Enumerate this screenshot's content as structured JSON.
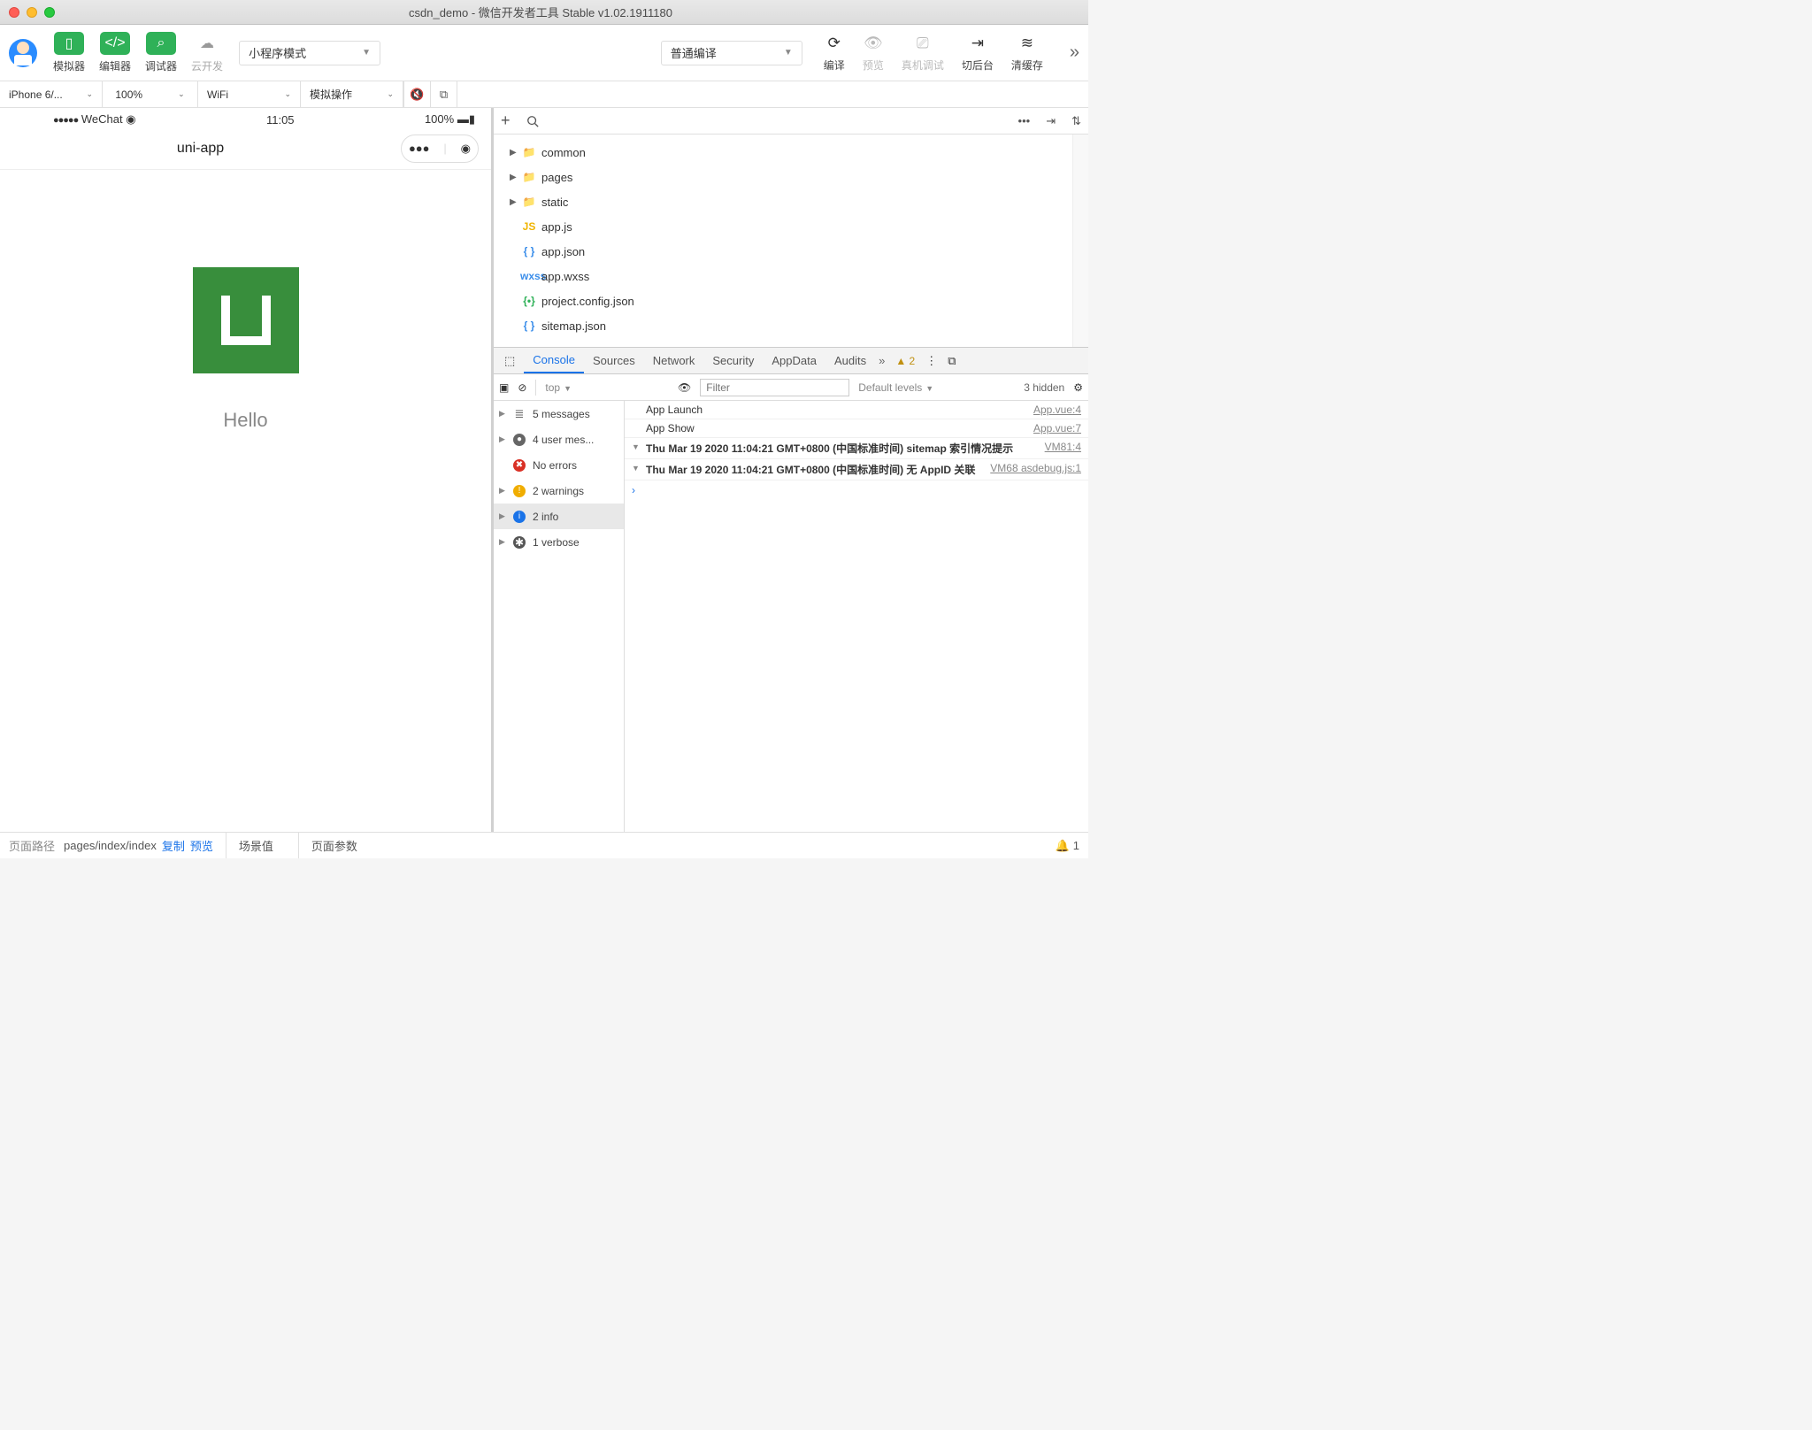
{
  "window": {
    "title": "csdn_demo - 微信开发者工具 Stable v1.02.1911180"
  },
  "toolbar": {
    "simulator": "模拟器",
    "editor": "编辑器",
    "debugger": "调试器",
    "cloud": "云开发",
    "mode": "小程序模式",
    "compile_mode": "普通编译",
    "compile": "编译",
    "preview": "预览",
    "remote_debug": "真机调试",
    "background": "切后台",
    "clear_cache": "清缓存"
  },
  "secbar": {
    "device": "iPhone 6/...",
    "zoom": "100%",
    "network": "WiFi",
    "sim_action": "模拟操作"
  },
  "simulator": {
    "carrier": "WeChat",
    "time": "11:05",
    "battery": "100%",
    "app_title": "uni-app",
    "hello": "Hello"
  },
  "tree": {
    "folders": [
      "common",
      "pages",
      "static"
    ],
    "files": [
      {
        "name": "app.js",
        "icon": "js"
      },
      {
        "name": "app.json",
        "icon": "json"
      },
      {
        "name": "app.wxss",
        "icon": "wxss"
      },
      {
        "name": "project.config.json",
        "icon": "cfg"
      },
      {
        "name": "sitemap.json",
        "icon": "json"
      }
    ]
  },
  "devtools": {
    "tabs": [
      "Console",
      "Sources",
      "Network",
      "Security",
      "AppData",
      "Audits"
    ],
    "warn_count": "2",
    "context": "top",
    "filter_placeholder": "Filter",
    "levels": "Default levels",
    "hidden": "3 hidden",
    "sidebar": [
      {
        "label": "5 messages",
        "badge": "list"
      },
      {
        "label": "4 user mes...",
        "badge": "user"
      },
      {
        "label": "No errors",
        "badge": "err"
      },
      {
        "label": "2 warnings",
        "badge": "warn"
      },
      {
        "label": "2 info",
        "badge": "info",
        "selected": true
      },
      {
        "label": "1 verbose",
        "badge": "verb"
      }
    ],
    "logs": [
      {
        "msg": "App Launch",
        "src": "App.vue:4",
        "arrow": ""
      },
      {
        "msg": "App Show",
        "src": "App.vue:7",
        "arrow": ""
      },
      {
        "msg": "Thu Mar 19 2020 11:04:21 GMT+0800 (中国标准时间) sitemap 索引情况提示",
        "src": "VM81:4",
        "arrow": "▼",
        "bold": true
      },
      {
        "msg": "Thu Mar 19 2020 11:04:21 GMT+0800 (中国标准时间) 无 AppID 关联",
        "src": "VM68 asdebug.js:1",
        "arrow": "▼",
        "bold": true
      }
    ]
  },
  "footer": {
    "path_label": "页面路径",
    "path": "pages/index/index",
    "copy": "复制",
    "preview": "预览",
    "scene": "场景值",
    "params": "页面参数",
    "notif": "1"
  }
}
